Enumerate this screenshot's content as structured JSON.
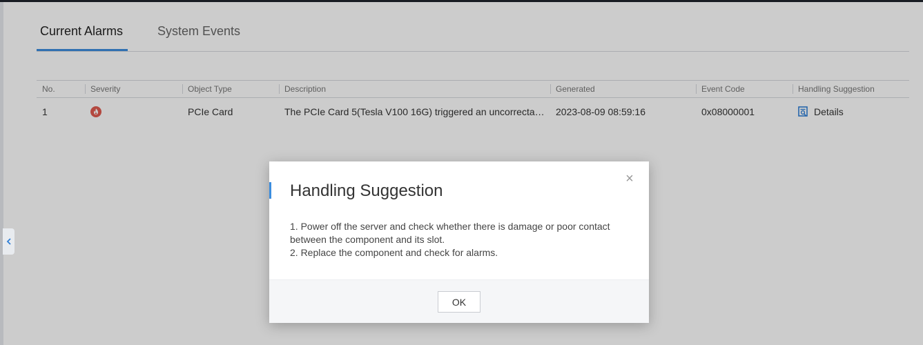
{
  "tabs": [
    {
      "label": "Current Alarms",
      "active": true
    },
    {
      "label": "System Events",
      "active": false
    }
  ],
  "table": {
    "columns": [
      "No.",
      "Severity",
      "Object Type",
      "Description",
      "Generated",
      "Event Code",
      "Handling Suggestion"
    ],
    "rows": [
      {
        "no": "1",
        "severity": "critical",
        "object_type": "PCIe Card",
        "description": "The PCIe Card 5(Tesla V100 16G) triggered an uncorrectab…",
        "generated": "2023-08-09 08:59:16",
        "event_code": "0x08000001",
        "suggestion_link": "Details"
      }
    ]
  },
  "modal": {
    "title": "Handling Suggestion",
    "body_lines": [
      "1. Power off the server and check whether there is damage or poor contact between the component and its slot.",
      "2. Replace the component and check for alarms."
    ],
    "ok_label": "OK",
    "close_glyph": "×"
  },
  "colors": {
    "accent": "#3c8dde",
    "critical": "#e05a4f",
    "overlay": "rgba(0,0,0,0.2)"
  },
  "icons": {
    "severity": "flame-icon",
    "details": "document-search-icon",
    "collapse": "chevron-left-icon"
  }
}
